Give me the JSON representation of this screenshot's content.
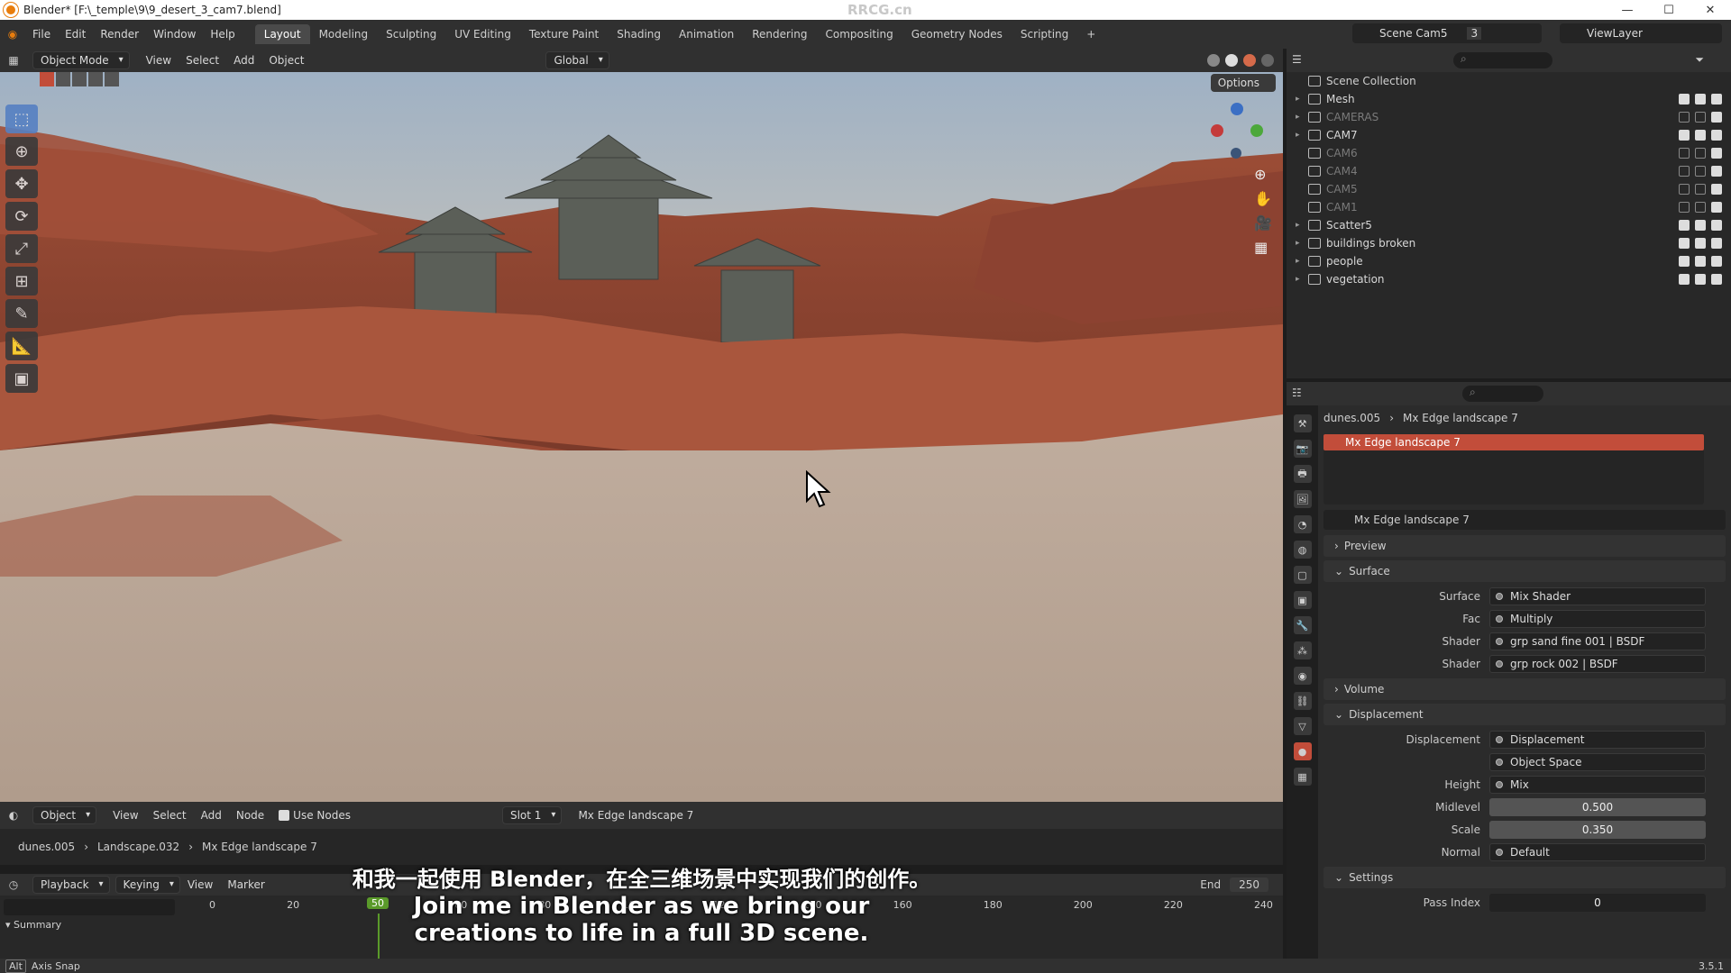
{
  "window_title": "Blender* [F:\\_temple\\9\\9_desert_3_cam7.blend]",
  "watermark": "RRCG.cn",
  "menu": [
    "File",
    "Edit",
    "Render",
    "Window",
    "Help"
  ],
  "workspaces": [
    "Layout",
    "Modeling",
    "Sculpting",
    "UV Editing",
    "Texture Paint",
    "Shading",
    "Animation",
    "Rendering",
    "Compositing",
    "Geometry Nodes",
    "Scripting"
  ],
  "active_workspace": "Layout",
  "scene_name": "Scene Cam5",
  "scene_count": "3",
  "view_layer": "ViewLayer",
  "viewport_header": {
    "mode": "Object Mode",
    "view": "View",
    "select": "Select",
    "add": "Add",
    "object": "Object",
    "orientation": "Global",
    "options": "Options"
  },
  "outliner": {
    "root": "Scene Collection",
    "rows": [
      {
        "label": "Mesh",
        "dim": false,
        "expanded": true
      },
      {
        "label": "CAMERAS",
        "dim": true,
        "expanded": true
      },
      {
        "label": "CAM7",
        "dim": false,
        "expanded": true
      },
      {
        "label": "CAM6",
        "dim": true,
        "expanded": false
      },
      {
        "label": "CAM4",
        "dim": true,
        "expanded": false
      },
      {
        "label": "CAM5",
        "dim": true,
        "expanded": false
      },
      {
        "label": "CAM1",
        "dim": true,
        "expanded": false
      },
      {
        "label": "Scatter5",
        "dim": false,
        "expanded": true
      },
      {
        "label": "buildings broken",
        "dim": false,
        "expanded": true
      },
      {
        "label": "people",
        "dim": false,
        "expanded": true
      },
      {
        "label": "vegetation",
        "dim": false,
        "expanded": true
      }
    ]
  },
  "properties": {
    "breadcrumb_object": "dunes.005",
    "breadcrumb_material": "Mx Edge landscape 7",
    "material_slot": "Mx Edge landscape 7",
    "material_name": "Mx Edge landscape 7",
    "panels": {
      "preview": "Preview",
      "surface": "Surface",
      "volume": "Volume",
      "displacement": "Displacement",
      "settings": "Settings"
    },
    "surface_rows": [
      {
        "label": "Surface",
        "value": "Mix Shader"
      },
      {
        "label": "Fac",
        "value": "Multiply"
      },
      {
        "label": "Shader",
        "value": "grp sand fine 001 | BSDF"
      },
      {
        "label": "Shader",
        "value": "grp rock 002 | BSDF"
      }
    ],
    "displacement_rows": [
      {
        "label": "Displacement",
        "value": "Displacement"
      },
      {
        "label": "",
        "value": "Object Space"
      },
      {
        "label": "Height",
        "value": "Mix"
      }
    ],
    "midlevel_label": "Midlevel",
    "midlevel": "0.500",
    "scale_label": "Scale",
    "scale": "0.350",
    "normal_label": "Normal",
    "normal": "Default",
    "pass_index_label": "Pass Index",
    "pass_index": "0"
  },
  "node_header": {
    "object": "Object",
    "view": "View",
    "select": "Select",
    "add": "Add",
    "node": "Node",
    "use_nodes": "Use Nodes",
    "slot": "Slot 1",
    "material": "Mx Edge landscape 7"
  },
  "node_breadcrumb": [
    "dunes.005",
    "Landscape.032",
    "Mx Edge landscape 7"
  ],
  "timeline": {
    "playback": "Playback",
    "keying": "Keying",
    "view": "View",
    "marker": "Marker",
    "end_label": "End",
    "end": "250",
    "current": "50",
    "ticks": [
      "0",
      "20",
      "40",
      "60",
      "80",
      "100",
      "120",
      "140",
      "160",
      "180",
      "200",
      "220",
      "240"
    ],
    "summary": "Summary"
  },
  "status": {
    "key": "Alt",
    "action": "Axis Snap",
    "version": "3.5.1"
  },
  "subtitles": {
    "zh": "和我一起使用 Blender，在全三维场景中实现我们的创作。",
    "en_line1": "Join me in Blender as we bring our",
    "en_line2": "creations to life in a full 3D scene."
  },
  "colors": {
    "accent": "#c24d3a",
    "active_tool": "#5680c2",
    "frame": "#5a9a2a"
  }
}
